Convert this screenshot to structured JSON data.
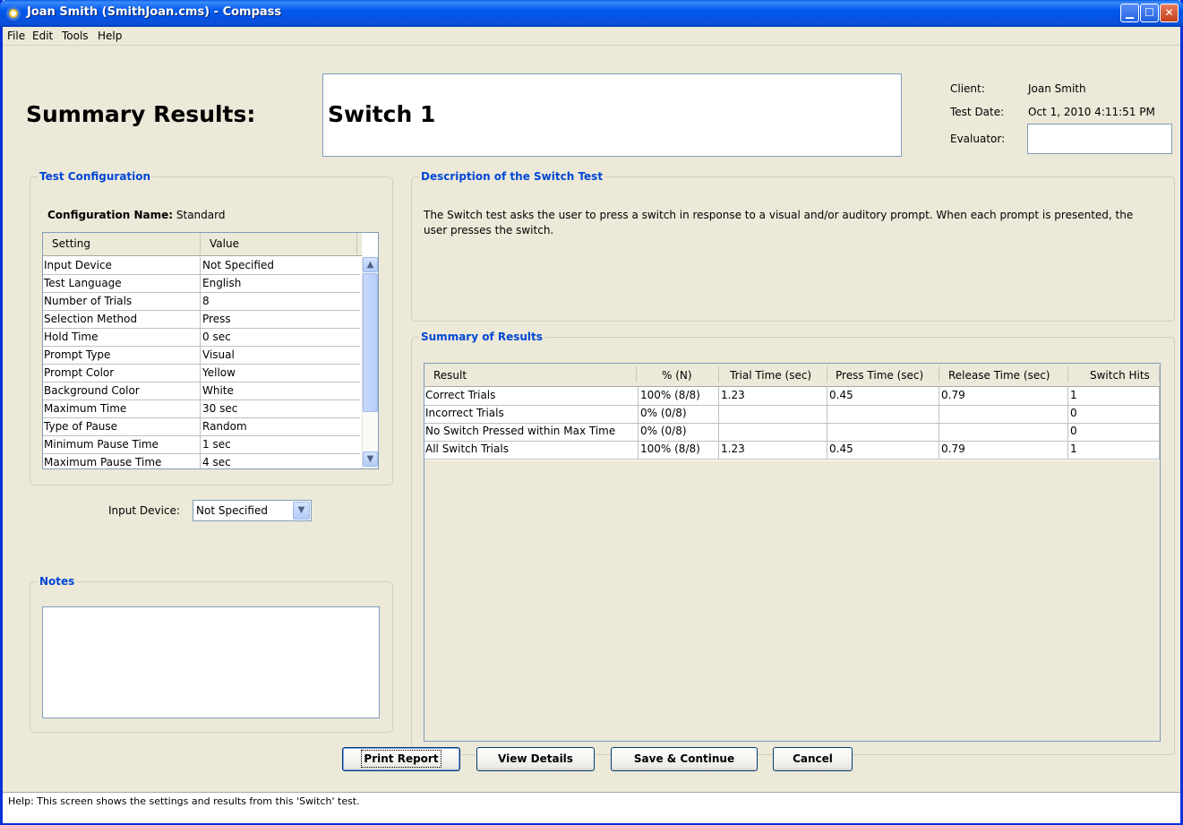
{
  "window": {
    "title": "Joan Smith (SmithJoan.cms) - Compass"
  },
  "menu": [
    "File",
    "Edit",
    "Tools",
    "Help"
  ],
  "header": {
    "heading": "Summary Results:",
    "test_name": "Switch 1",
    "client_label": "Client:",
    "client_value": "Joan Smith",
    "test_date_label": "Test Date:",
    "test_date_value": "Oct 1, 2010 4:11:51 PM",
    "evaluator_label": "Evaluator:",
    "evaluator_value": ""
  },
  "config": {
    "legend": "Test Configuration",
    "name_label": "Configuration Name:",
    "name_value": "Standard",
    "columns": [
      "Setting",
      "Value"
    ],
    "rows": [
      [
        "Input Device",
        "Not Specified"
      ],
      [
        "Test Language",
        "English"
      ],
      [
        "Number of Trials",
        "8"
      ],
      [
        "Selection Method",
        "Press"
      ],
      [
        "Hold Time",
        "0 sec"
      ],
      [
        "Prompt Type",
        "Visual"
      ],
      [
        "Prompt Color",
        "Yellow"
      ],
      [
        "Background Color",
        "White"
      ],
      [
        "Maximum Time",
        "30 sec"
      ],
      [
        "Type of Pause",
        "Random"
      ],
      [
        "Minimum Pause Time",
        "1 sec"
      ],
      [
        "Maximum Pause Time",
        "4 sec"
      ]
    ],
    "input_device_label": "Input Device:",
    "input_device_value": "Not Specified"
  },
  "notes": {
    "legend": "Notes",
    "value": ""
  },
  "description": {
    "legend": "Description of the Switch Test",
    "text": "The Switch test asks the user to press a switch in response to a visual and/or auditory prompt.  When each prompt is presented, the user presses the switch."
  },
  "summary": {
    "legend": "Summary of Results",
    "columns": [
      "Result",
      "% (N)",
      "Trial Time (sec)",
      "Press Time (sec)",
      "Release Time (sec)",
      "Switch Hits"
    ],
    "rows": [
      [
        "Correct Trials",
        "100% (8/8)",
        "1.23",
        "0.45",
        "0.79",
        "1"
      ],
      [
        "Incorrect Trials",
        "0% (0/8)",
        "",
        "",
        "",
        "0"
      ],
      [
        "No Switch Pressed within Max Time",
        "0% (0/8)",
        "",
        "",
        "",
        "0"
      ],
      [
        "All Switch Trials",
        "100% (8/8)",
        "1.23",
        "0.45",
        "0.79",
        "1"
      ]
    ]
  },
  "buttons": {
    "print": "Print Report",
    "view": "View Details",
    "save": "Save & Continue",
    "cancel": "Cancel"
  },
  "status": "Help:  This screen shows the settings and results from this 'Switch' test."
}
